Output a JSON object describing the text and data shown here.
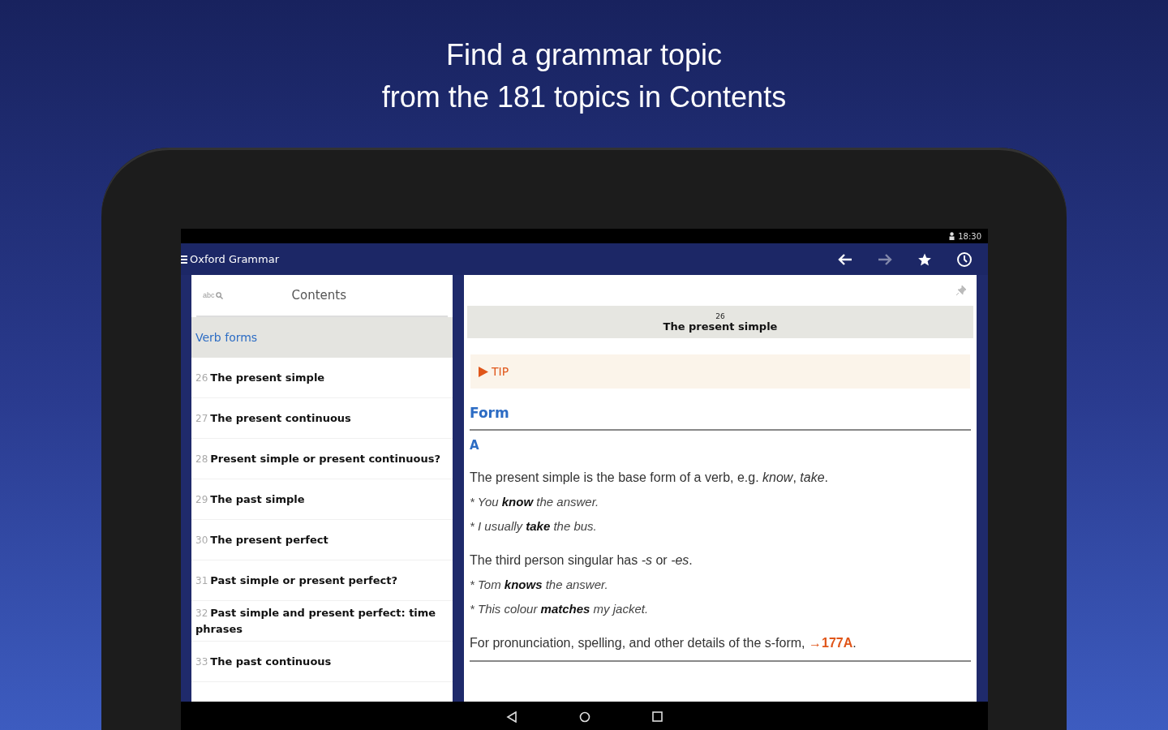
{
  "headline": [
    "Find a grammar topic",
    "from the 181 topics in Contents"
  ],
  "status_bar": {
    "time": "18:30"
  },
  "app_bar": {
    "title": "Oxford Grammar",
    "actions": [
      {
        "kind": "back",
        "disabled": false
      },
      {
        "kind": "forward",
        "disabled": true
      },
      {
        "kind": "bookmarks",
        "disabled": false
      },
      {
        "kind": "history",
        "disabled": false
      }
    ]
  },
  "contents": {
    "search_label": "abc",
    "title": "Contents",
    "sections": [
      {
        "label": "Verb forms",
        "selected": true
      }
    ],
    "items": [
      {
        "number": "26",
        "title": "The present simple"
      },
      {
        "number": "27",
        "title": "The present continuous"
      },
      {
        "number": "28",
        "title": "Present simple or present continuous?"
      },
      {
        "number": "29",
        "title": "The past simple"
      },
      {
        "number": "30",
        "title": "The present perfect"
      },
      {
        "number": "31",
        "title": "Past simple or present perfect?"
      },
      {
        "number": "32",
        "title": "Past simple and present perfect: time phrases"
      },
      {
        "number": "33",
        "title": "The past continuous"
      }
    ]
  },
  "article": {
    "number": "26",
    "title": "The present simple",
    "tip": "TIP",
    "heading": "Form",
    "section_letter": "A",
    "paragraphs": [
      {
        "kind": "text",
        "text": "The present simple is the base form of a verb, e.g. *know*, *take*."
      },
      {
        "kind": "example",
        "marker": "*",
        "text": "You **know** the answer."
      },
      {
        "kind": "example",
        "marker": "*",
        "text": "I usually **take** the bus."
      },
      {
        "kind": "text",
        "text": "The third person singular has *-s* or *-es*."
      },
      {
        "kind": "example",
        "marker": "*",
        "text": "Tom **knows** the answer."
      },
      {
        "kind": "example",
        "marker": "*",
        "text": "This colour **matches** my jacket."
      },
      {
        "kind": "reference",
        "text": "For pronunciation, spelling, and other details of the s-form,",
        "link": "→177A",
        "after": "."
      }
    ]
  }
}
